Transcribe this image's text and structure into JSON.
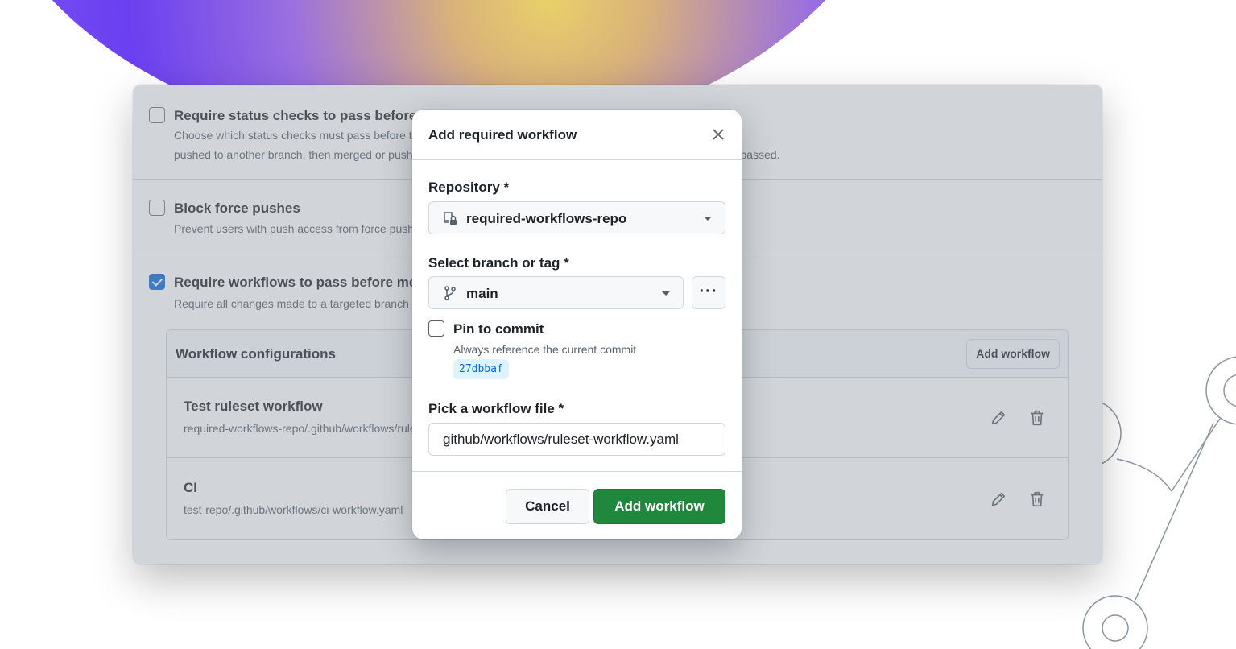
{
  "settings": {
    "status_checks": {
      "title": "Require status checks to pass before merging",
      "desc_line1": "Choose which status checks must pass before the ref is updated. When enabled, commits must first be",
      "desc_line2": "pushed to another branch, then merged or pushed directly to a ref that matches this rule after status checks have passed.",
      "checked": false
    },
    "block_force": {
      "title": "Block force pushes",
      "desc": "Prevent users with push access from force pushing to refs.",
      "checked": false
    },
    "require_workflows": {
      "title": "Require workflows to pass before merging",
      "desc": "Require all changes made to a targeted branch to pass the specified workflows before they can be merged.",
      "checked": true
    },
    "workflow_configs": {
      "title": "Workflow configurations",
      "add_button": "Add workflow",
      "rows": [
        {
          "name": "Test ruleset workflow",
          "path": "required-workflows-repo/.github/workflows/ruleset-workflow.yaml"
        },
        {
          "name": "CI",
          "path": "test-repo/.github/workflows/ci-workflow.yaml"
        }
      ]
    }
  },
  "modal": {
    "title": "Add required workflow",
    "repository_label": "Repository *",
    "repository_value": "required-workflows-repo",
    "branch_label": "Select branch or tag *",
    "branch_value": "main",
    "more_button": "···",
    "pin_label": "Pin to commit",
    "pin_desc": "Always reference the current commit",
    "pin_checked": false,
    "commit_sha": "27dbbaf",
    "file_label": "Pick a workflow file *",
    "file_value": "github/workflows/ruleset-workflow.yaml",
    "cancel_button": "Cancel",
    "add_button": "Add workflow"
  },
  "colors": {
    "accent_blue": "#0969da",
    "success_green": "#1f883d",
    "sha_bg": "#ddf4ff"
  },
  "icons": {
    "repo": "repo-locked-icon",
    "branch": "git-branch-icon",
    "close": "close-icon",
    "edit": "pencil-icon",
    "delete": "trash-icon"
  }
}
